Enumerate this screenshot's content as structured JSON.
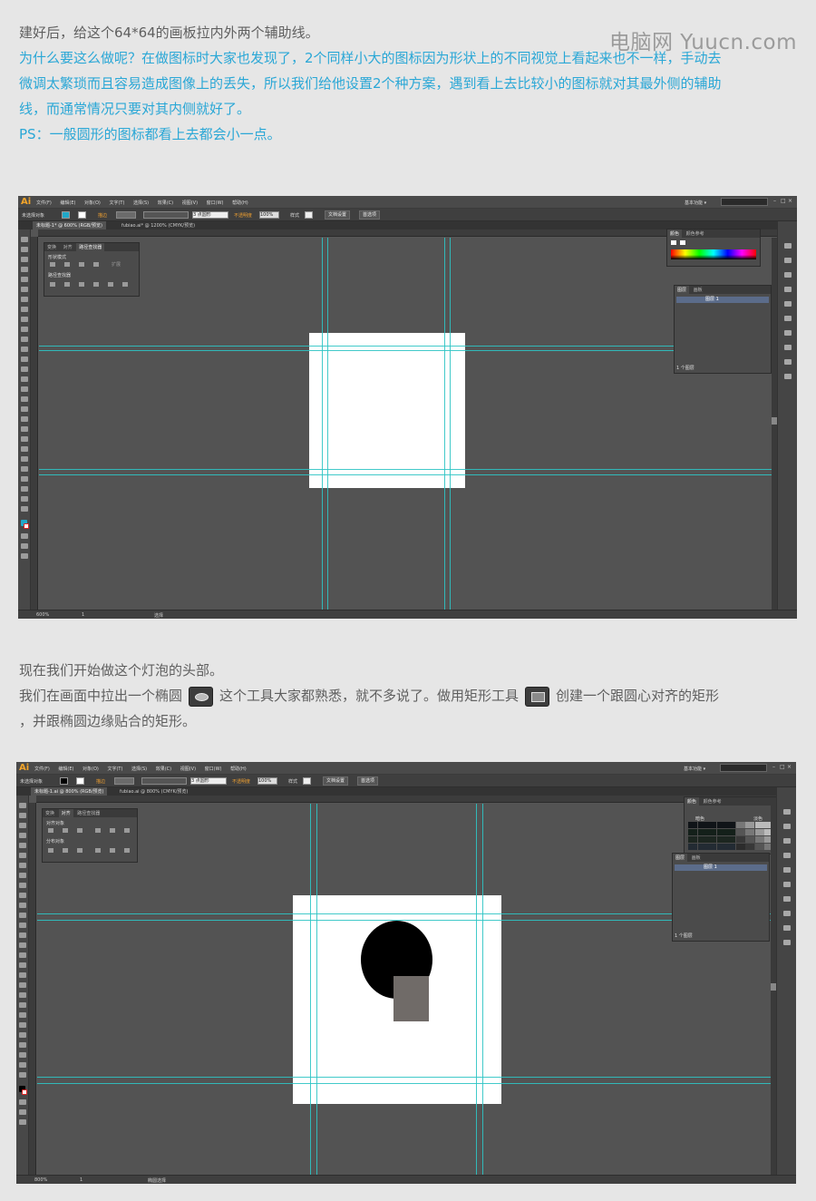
{
  "watermark": "电脑网 Yuucn.com",
  "intro": {
    "line1": "建好后，给这个64*64的画板拉内外两个辅助线。",
    "line2": "为什么要这么做呢？在做图标时大家也发现了，2个同样小大的图标因为形状上的不同视觉上看起来也不一样，手动去",
    "line3": "微调太繁琐而且容易造成图像上的丢失，所以我们给他设置2个种方案，遇到看上去比较小的图标就对其最外侧的辅助",
    "line4": "线，而通常情况只要对其内侧就好了。",
    "line5": "PS：一般圆形的图标都看上去都会小一点。"
  },
  "middle": {
    "line1": "现在我们开始做这个灯泡的头部。",
    "line2_a": "我们在画面中拉出一个椭圆",
    "line2_b": "这个工具大家都熟悉，就不多说了。做用矩形工具",
    "line2_c": "创建一个跟圆心对齐的矩形",
    "line3": "，并跟椭圆边缘贴合的矩形。",
    "ellipse_tool_icon": "ellipse-tool-icon",
    "rect_tool_icon": "rectangle-tool-icon"
  },
  "shot1": {
    "logo": "Ai",
    "menus": [
      "文件(F)",
      "编辑(E)",
      "对象(O)",
      "文字(T)",
      "选择(S)",
      "效果(C)",
      "视图(V)",
      "窗口(W)",
      "帮助(H)"
    ],
    "workspace": "基本功能 ▾",
    "ctrl_label": "未选择对象",
    "stroke_label": "描边",
    "opacity_label": "不透明度",
    "opacity_value": "100%",
    "style_label": "样式",
    "docsetup_btn": "文档设置",
    "prefs_btn": "首选项",
    "points_value": "3 点圆形",
    "tab_active": "未标题-1* @ 600% (RGB/预览)",
    "tab_other": "fubiao.ai* @ 1200% (CMYK/预览)",
    "zoom": "600%",
    "status_text": "选择",
    "page_num": "1",
    "panel1": {
      "tabs": [
        "变换",
        "对齐",
        "路径查找器"
      ],
      "section1": "形状模式",
      "section2": "路径查找器",
      "expand_btn": "扩展"
    },
    "color_panel_tabs": [
      "颜色",
      "颜色参考"
    ],
    "layers_panel_tabs": [
      "图层",
      "画板"
    ],
    "layer_name": "图层 1",
    "layer_count": "1 个图层"
  },
  "shot2": {
    "logo": "Ai",
    "menus": [
      "文件(F)",
      "编辑(E)",
      "对象(O)",
      "文字(T)",
      "选择(S)",
      "效果(C)",
      "视图(V)",
      "窗口(W)",
      "帮助(H)"
    ],
    "workspace": "基本功能 ▾",
    "ctrl_label": "未选择对象",
    "stroke_label": "描边",
    "opacity_label": "不透明度",
    "opacity_value": "100%",
    "style_label": "样式",
    "docsetup_btn": "文档设置",
    "prefs_btn": "首选项",
    "points_value": "3 点圆形",
    "tab_active": "未标题-1.ai @ 800% (RGB/预览)",
    "tab_other": "fubiao.ai @ 800% (CMYK/预览)",
    "zoom": "800%",
    "status_text": "椭圆选择",
    "page_num": "1",
    "panel1": {
      "tabs": [
        "变换",
        "对齐",
        "路径查找器"
      ],
      "section1": "对齐对象",
      "section2": "分布对象"
    },
    "swatch_panel_tabs": [
      "颜色",
      "颜色参考"
    ],
    "swatch_labels": [
      "暗色",
      "淡色"
    ],
    "layers_panel_tabs": [
      "图层",
      "画板"
    ],
    "layer_name": "图层 1",
    "layer_count": "1 个图层",
    "circle_color": "#000000",
    "rect_color": "#706b68"
  }
}
